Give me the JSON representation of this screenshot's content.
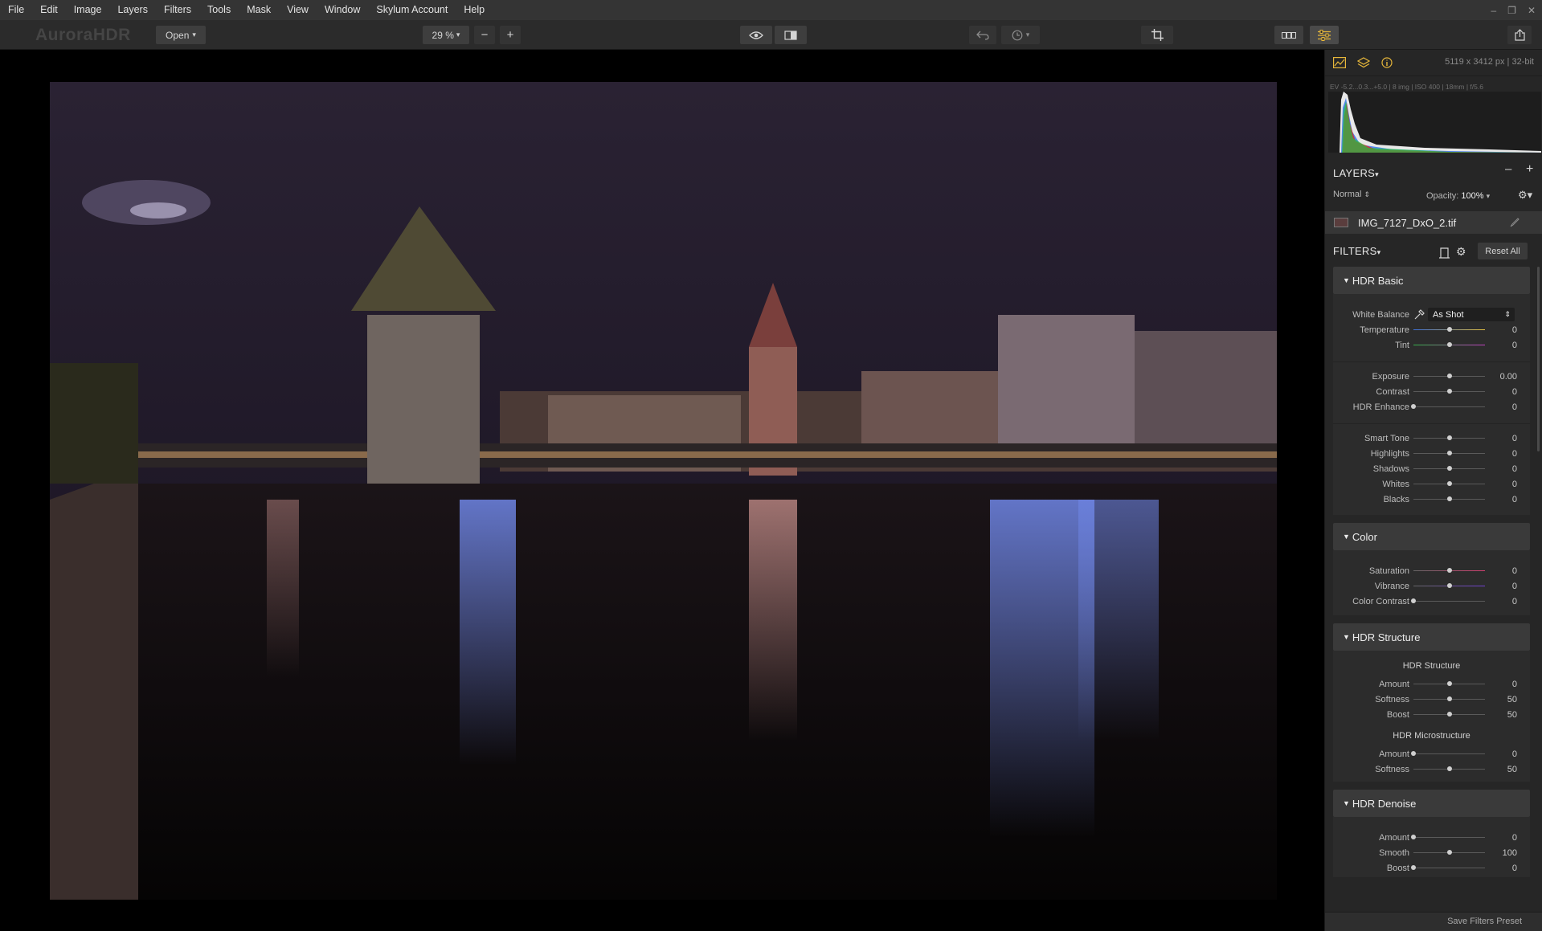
{
  "menu": [
    "File",
    "Edit",
    "Image",
    "Layers",
    "Filters",
    "Tools",
    "Mask",
    "View",
    "Window",
    "Skylum Account",
    "Help"
  ],
  "app": {
    "logo": "AuroraHDR"
  },
  "toolbar": {
    "open_label": "Open",
    "zoom": "29 %"
  },
  "info": {
    "dimensions": "5119 x 3412 px  |  32-bit",
    "exif": "EV -5.2...0.3...+5.0  |  8 img  |  ISO 400  |  18mm  |  f/5.6"
  },
  "layers": {
    "title": "LAYERS",
    "blend_mode": "Normal",
    "opacity_label": "Opacity:",
    "opacity_value": "100%",
    "layer_name": "IMG_7127_DxO_2.tif"
  },
  "filters": {
    "title": "FILTERS",
    "reset_label": "Reset All",
    "save_preset": "Save Filters Preset",
    "white_balance_label": "White Balance",
    "white_balance_value": "As Shot",
    "groups": {
      "hdr_basic": {
        "title": "HDR Basic",
        "rows": [
          {
            "label": "Temperature",
            "value": "0",
            "pos": 0.5
          },
          {
            "label": "Tint",
            "value": "0",
            "pos": 0.5
          },
          {
            "label": "Exposure",
            "value": "0.00",
            "pos": 0.5
          },
          {
            "label": "Contrast",
            "value": "0",
            "pos": 0.5
          },
          {
            "label": "HDR Enhance",
            "value": "0",
            "pos": 0
          },
          {
            "label": "Smart Tone",
            "value": "0",
            "pos": 0.5
          },
          {
            "label": "Highlights",
            "value": "0",
            "pos": 0.5
          },
          {
            "label": "Shadows",
            "value": "0",
            "pos": 0.5
          },
          {
            "label": "Whites",
            "value": "0",
            "pos": 0.5
          },
          {
            "label": "Blacks",
            "value": "0",
            "pos": 0.5
          }
        ]
      },
      "color": {
        "title": "Color",
        "rows": [
          {
            "label": "Saturation",
            "value": "0",
            "pos": 0.5
          },
          {
            "label": "Vibrance",
            "value": "0",
            "pos": 0.5
          },
          {
            "label": "Color Contrast",
            "value": "0",
            "pos": 0
          }
        ]
      },
      "hdr_structure": {
        "title": "HDR Structure",
        "sub1": "HDR Structure",
        "rows1": [
          {
            "label": "Amount",
            "value": "0",
            "pos": 0.5
          },
          {
            "label": "Softness",
            "value": "50",
            "pos": 0.5
          },
          {
            "label": "Boost",
            "value": "50",
            "pos": 0.5
          }
        ],
        "sub2": "HDR Microstructure",
        "rows2": [
          {
            "label": "Amount",
            "value": "0",
            "pos": 0
          },
          {
            "label": "Softness",
            "value": "50",
            "pos": 0.5
          }
        ]
      },
      "hdr_denoise": {
        "title": "HDR Denoise",
        "rows": [
          {
            "label": "Amount",
            "value": "0",
            "pos": 0
          },
          {
            "label": "Smooth",
            "value": "100",
            "pos": 0.5
          },
          {
            "label": "Boost",
            "value": "0",
            "pos": 0
          }
        ]
      }
    }
  },
  "colors": {
    "panel": "#262626",
    "accent_yellow": "#e7b73a",
    "slider_thumb": "#cfcfcf"
  }
}
